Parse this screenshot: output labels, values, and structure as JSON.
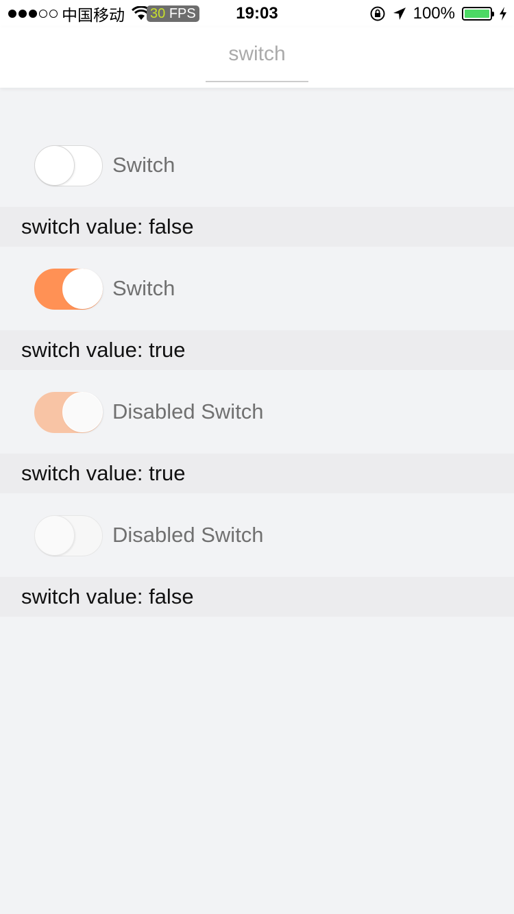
{
  "status_bar": {
    "carrier": "中国移动",
    "fps_value": "30",
    "fps_label": "FPS",
    "time": "19:03",
    "battery_percent": "100%",
    "signal_bars_filled": 3,
    "signal_bars_total": 5,
    "battery_level": 1.0
  },
  "nav": {
    "tab_label": "switch"
  },
  "items": [
    {
      "label": "Switch",
      "checked": false,
      "disabled": false,
      "value_text": "switch value: false"
    },
    {
      "label": "Switch",
      "checked": true,
      "disabled": false,
      "value_text": "switch value: true"
    },
    {
      "label": "Disabled Switch",
      "checked": true,
      "disabled": true,
      "value_text": "switch value: true"
    },
    {
      "label": "Disabled Switch",
      "checked": false,
      "disabled": true,
      "value_text": "switch value: false"
    }
  ],
  "colors": {
    "accent": "#ff9155",
    "accent_disabled": "#f8c4a5",
    "background": "#f2f3f5",
    "value_row_bg": "#ececee",
    "battery_fill": "#4cd964"
  },
  "icons": [
    "wifi-icon",
    "orientation-lock-icon",
    "location-arrow-icon",
    "battery-icon",
    "charging-bolt-icon"
  ]
}
